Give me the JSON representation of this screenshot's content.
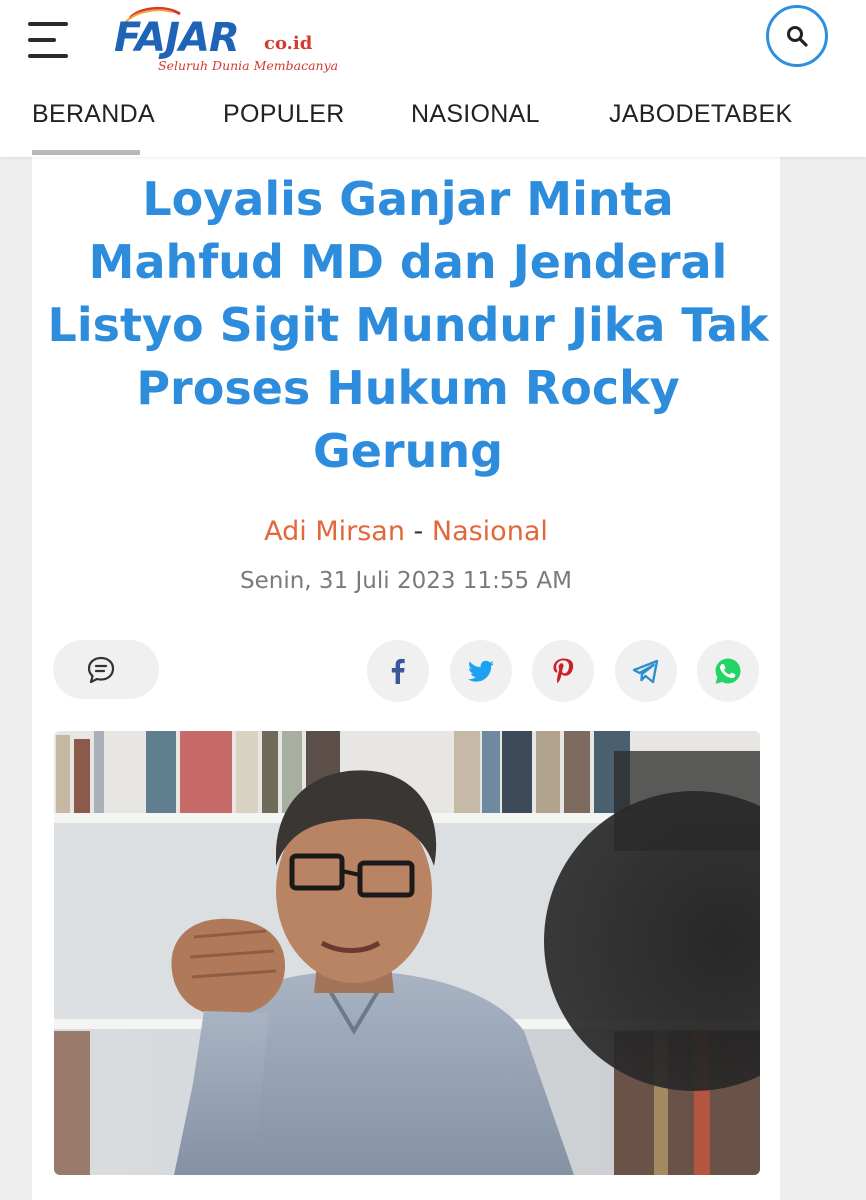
{
  "header": {
    "logo_name": "FAJAR",
    "logo_suffix": "co.id",
    "logo_tagline": "Seluruh Dunia Membacanya",
    "menu_icon": "hamburger-menu-icon",
    "search_icon": "search-icon"
  },
  "nav": {
    "items": [
      "BERANDA",
      "POPULER",
      "NASIONAL",
      "JABODETABEK"
    ],
    "active_index": 0
  },
  "article": {
    "title": "Loyalis Ganjar Minta Mahfud MD dan Jenderal Listyo Sigit Mundur Jika Tak Proses Hukum Rocky Gerung",
    "author": "Adi Mirsan",
    "separator": " - ",
    "category": "Nasional",
    "date": "Senin, 31 Juli 2023 11:55 AM"
  },
  "actions": {
    "comment_icon": "comment-icon",
    "share_icons": [
      "facebook-icon",
      "twitter-icon",
      "pinterest-icon",
      "telegram-icon",
      "whatsapp-icon"
    ]
  },
  "colors": {
    "title": "#2d8ddc",
    "author_link": "#e1683a",
    "logo_blue": "#1e63b6",
    "logo_red": "#d43a2f",
    "facebook": "#3b5998",
    "twitter": "#1da1f2",
    "pinterest": "#cb2027",
    "telegram": "#2f8fce",
    "whatsapp": "#25d366"
  }
}
